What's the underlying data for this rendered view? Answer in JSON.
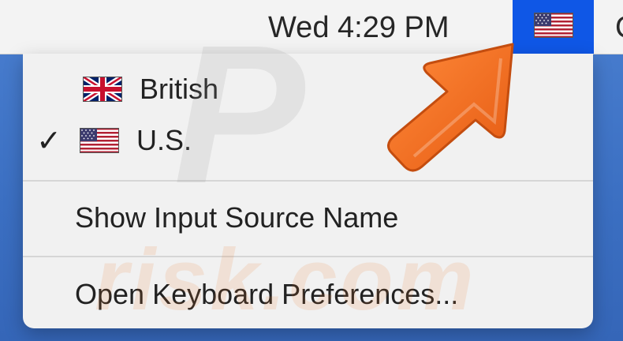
{
  "menubar": {
    "clock": "Wed 4:29 PM",
    "input_source_icon": "us-flag-icon"
  },
  "menu": {
    "sources": [
      {
        "label": "British",
        "icon": "uk-flag-icon",
        "checked": false
      },
      {
        "label": "U.S.",
        "icon": "us-flag-icon",
        "checked": true,
        "check_mark": "✓"
      }
    ],
    "show_input_source_name": "Show Input Source Name",
    "open_keyboard_preferences": "Open Keyboard Preferences..."
  },
  "overlay": {
    "arrow_color": "#f26b1d",
    "watermark": "risk.com"
  },
  "colors": {
    "menubar_highlight": "#0f57e6",
    "desktop": "#3f74c4"
  }
}
